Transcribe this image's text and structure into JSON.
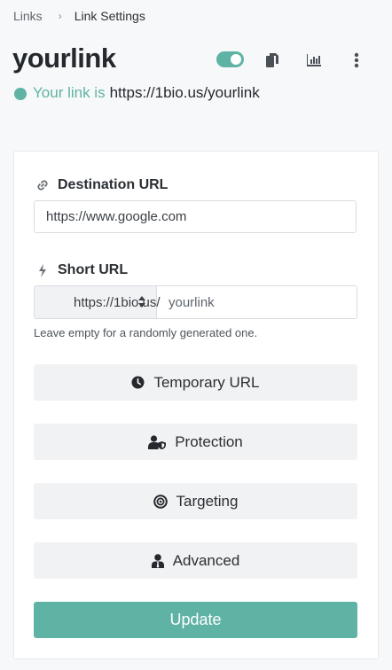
{
  "breadcrumb": {
    "parent": "Links",
    "separator": "›",
    "current": "Link Settings"
  },
  "header": {
    "title": "yourlink",
    "enabled": true,
    "icons": [
      "toggle",
      "copy-icon",
      "stats-icon",
      "more-vert-icon"
    ]
  },
  "link_info": {
    "prefix": "Your link is",
    "url": "https://1bio.us/yourlink",
    "status_color": "#5fb3a4"
  },
  "form": {
    "destination": {
      "label": "Destination URL",
      "icon": "link-icon",
      "value": "https://www.google.com"
    },
    "short_url": {
      "label": "Short URL",
      "icon": "bolt-icon",
      "domain": "https://1bio.us/",
      "placeholder": "yourlink",
      "help": "Leave empty for a randomly generated one."
    },
    "sections": {
      "temporary": {
        "label": "Temporary URL",
        "icon": "clock-icon"
      },
      "protection": {
        "label": "Protection",
        "icon": "user-shield-icon"
      },
      "targeting": {
        "label": "Targeting",
        "icon": "target-icon"
      },
      "advanced": {
        "label": "Advanced",
        "icon": "user-tie-icon"
      }
    },
    "submit_label": "Update"
  },
  "colors": {
    "accent": "#5fb3a4",
    "button_bg": "#f1f2f4"
  }
}
